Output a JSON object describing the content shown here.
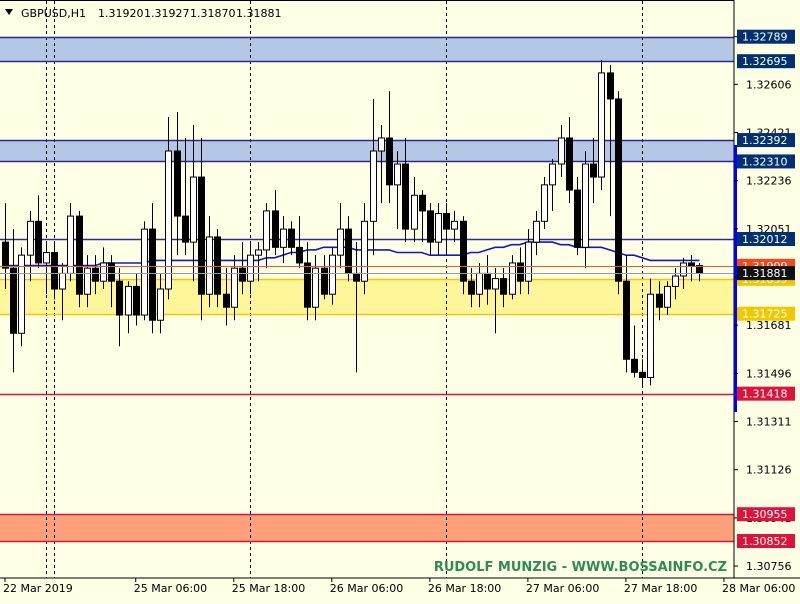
{
  "header": {
    "symbol": "GBPUSD,H1",
    "open": "1.31920",
    "high": "1.31927",
    "low": "1.31870",
    "close": "1.31881"
  },
  "watermark": "RUDOLF MUNZIG - WWW.BOSSAINFO.CZ",
  "colors": {
    "background": "#FFFFE6",
    "bull_candle": "#FFFFFF",
    "bear_candle": "#000000",
    "ma_line": "#1515C8",
    "blue_zone": "#B4C8E6",
    "blue_line": "#2B2B8F",
    "yellow_zone": "#FFF599",
    "yellow_border": "#F0C800",
    "red_zone": "#FFA07A",
    "red_line": "#D2143C",
    "label_dark": "#003070",
    "label_yellow": "#F0C800",
    "label_red": "#DC143C",
    "watermark": "#2E8B57"
  },
  "chart_data": {
    "type": "candlestick",
    "symbol": "GBPUSD",
    "timeframe": "H1",
    "ylim": [
      1.3071,
      1.3293
    ],
    "y_ticks": [
      "1.32789",
      "1.32606",
      "1.32421",
      "1.32236",
      "1.32051",
      "1.31866",
      "1.31681",
      "1.31496",
      "1.31311",
      "1.31126",
      "1.30941",
      "1.30756"
    ],
    "x_tick_labels": [
      "22 Mar 2019",
      "25 Mar 06:00",
      "25 Mar 18:00",
      "26 Mar 06:00",
      "26 Mar 18:00",
      "27 Mar 06:00",
      "27 Mar 18:00",
      "28 Mar 06:00"
    ],
    "x_tick_positions": [
      0,
      16,
      28,
      40,
      52,
      64,
      76,
      88
    ],
    "vertical_separators": [
      5,
      6,
      30,
      54,
      78
    ],
    "current_price": {
      "label": "1.31881",
      "value": 1.31881
    },
    "red_price_line": {
      "label": "1.31909",
      "value": 1.31909
    },
    "levels": [
      {
        "label": "1.32789",
        "value": 1.32789,
        "kind": "blue"
      },
      {
        "label": "1.32695",
        "value": 1.32695,
        "kind": "blue"
      },
      {
        "label": "1.32392",
        "value": 1.32392,
        "kind": "blue"
      },
      {
        "label": "1.32310",
        "value": 1.3231,
        "kind": "blue"
      },
      {
        "label": "1.32012",
        "value": 1.32012,
        "kind": "blue"
      },
      {
        "label": "1.31859",
        "value": 1.31859,
        "kind": "yellow"
      },
      {
        "label": "1.31725",
        "value": 1.31725,
        "kind": "yellow"
      },
      {
        "label": "1.31418",
        "value": 1.31418,
        "kind": "red"
      },
      {
        "label": "1.30955",
        "value": 1.30955,
        "kind": "red"
      },
      {
        "label": "1.30852",
        "value": 1.30852,
        "kind": "red"
      }
    ],
    "zones": [
      {
        "from": 1.32695,
        "to": 1.32789,
        "kind": "blue"
      },
      {
        "from": 1.3231,
        "to": 1.32392,
        "kind": "blue"
      },
      {
        "from": 1.31725,
        "to": 1.31859,
        "kind": "yellow"
      },
      {
        "from": 1.30852,
        "to": 1.30955,
        "kind": "red"
      }
    ],
    "ohlc": [
      [
        1.32,
        1.3215,
        1.3182,
        1.319
      ],
      [
        1.319,
        1.3205,
        1.315,
        1.3165
      ],
      [
        1.3165,
        1.3198,
        1.316,
        1.3195
      ],
      [
        1.3195,
        1.3212,
        1.3185,
        1.3208
      ],
      [
        1.3208,
        1.3218,
        1.319,
        1.3192
      ],
      [
        1.3192,
        1.32,
        1.318,
        1.3196
      ],
      [
        1.3196,
        1.32,
        1.3178,
        1.3182
      ],
      [
        1.3182,
        1.3192,
        1.317,
        1.3188
      ],
      [
        1.3188,
        1.3215,
        1.3185,
        1.321
      ],
      [
        1.321,
        1.3212,
        1.3175,
        1.318
      ],
      [
        1.318,
        1.3195,
        1.3175,
        1.319
      ],
      [
        1.319,
        1.3195,
        1.318,
        1.3185
      ],
      [
        1.3185,
        1.3198,
        1.3182,
        1.3192
      ],
      [
        1.3192,
        1.3195,
        1.3175,
        1.3185
      ],
      [
        1.3185,
        1.319,
        1.316,
        1.3172
      ],
      [
        1.3172,
        1.3185,
        1.3165,
        1.3183
      ],
      [
        1.3183,
        1.3188,
        1.3168,
        1.3172
      ],
      [
        1.3172,
        1.3208,
        1.317,
        1.3205
      ],
      [
        1.3205,
        1.3215,
        1.3165,
        1.317
      ],
      [
        1.317,
        1.3188,
        1.3165,
        1.3182
      ],
      [
        1.3182,
        1.3248,
        1.3178,
        1.3235
      ],
      [
        1.3235,
        1.325,
        1.3195,
        1.321
      ],
      [
        1.321,
        1.324,
        1.3195,
        1.32
      ],
      [
        1.32,
        1.3245,
        1.3185,
        1.3225
      ],
      [
        1.3225,
        1.324,
        1.317,
        1.318
      ],
      [
        1.318,
        1.321,
        1.3175,
        1.3202
      ],
      [
        1.3202,
        1.3205,
        1.3175,
        1.318
      ],
      [
        1.318,
        1.319,
        1.3168,
        1.3175
      ],
      [
        1.3175,
        1.3195,
        1.317,
        1.319
      ],
      [
        1.319,
        1.32,
        1.318,
        1.3185
      ],
      [
        1.3185,
        1.32,
        1.318,
        1.3195
      ],
      [
        1.3195,
        1.32,
        1.3185,
        1.3197
      ],
      [
        1.3197,
        1.3215,
        1.319,
        1.3212
      ],
      [
        1.3212,
        1.322,
        1.3195,
        1.3198
      ],
      [
        1.3198,
        1.321,
        1.3192,
        1.3205
      ],
      [
        1.3205,
        1.3208,
        1.3195,
        1.3198
      ],
      [
        1.3198,
        1.321,
        1.319,
        1.3192
      ],
      [
        1.3192,
        1.32,
        1.317,
        1.3175
      ],
      [
        1.3175,
        1.3195,
        1.317,
        1.319
      ],
      [
        1.319,
        1.3195,
        1.3178,
        1.318
      ],
      [
        1.318,
        1.3198,
        1.3176,
        1.3195
      ],
      [
        1.3195,
        1.3215,
        1.319,
        1.3205
      ],
      [
        1.3205,
        1.321,
        1.3185,
        1.3188
      ],
      [
        1.3188,
        1.32,
        1.315,
        1.3185
      ],
      [
        1.3185,
        1.3215,
        1.318,
        1.3208
      ],
      [
        1.3208,
        1.3255,
        1.3195,
        1.3235
      ],
      [
        1.3235,
        1.3245,
        1.3215,
        1.324
      ],
      [
        1.324,
        1.3258,
        1.3215,
        1.3222
      ],
      [
        1.3222,
        1.3235,
        1.3205,
        1.323
      ],
      [
        1.323,
        1.324,
        1.32,
        1.3205
      ],
      [
        1.3205,
        1.3225,
        1.32,
        1.3218
      ],
      [
        1.3218,
        1.322,
        1.32,
        1.3212
      ],
      [
        1.3212,
        1.3215,
        1.3195,
        1.32
      ],
      [
        1.32,
        1.3215,
        1.3195,
        1.3211
      ],
      [
        1.3211,
        1.3215,
        1.3195,
        1.3205
      ],
      [
        1.3205,
        1.3212,
        1.32,
        1.3208
      ],
      [
        1.3208,
        1.321,
        1.318,
        1.3185
      ],
      [
        1.3185,
        1.319,
        1.3175,
        1.318
      ],
      [
        1.318,
        1.3192,
        1.3175,
        1.3188
      ],
      [
        1.3188,
        1.3195,
        1.3176,
        1.3182
      ],
      [
        1.3182,
        1.319,
        1.3165,
        1.3186
      ],
      [
        1.3186,
        1.319,
        1.3175,
        1.318
      ],
      [
        1.318,
        1.3195,
        1.3178,
        1.3192
      ],
      [
        1.3192,
        1.3198,
        1.318,
        1.3185
      ],
      [
        1.3185,
        1.3205,
        1.318,
        1.32
      ],
      [
        1.32,
        1.3212,
        1.3195,
        1.3208
      ],
      [
        1.3208,
        1.3225,
        1.3205,
        1.3222
      ],
      [
        1.3222,
        1.3232,
        1.3212,
        1.323
      ],
      [
        1.323,
        1.3245,
        1.3225,
        1.324
      ],
      [
        1.324,
        1.3248,
        1.3215,
        1.322
      ],
      [
        1.322,
        1.3225,
        1.3195,
        1.3198
      ],
      [
        1.3198,
        1.3235,
        1.319,
        1.323
      ],
      [
        1.323,
        1.324,
        1.3215,
        1.3225
      ],
      [
        1.3225,
        1.327,
        1.322,
        1.3265
      ],
      [
        1.3265,
        1.3268,
        1.321,
        1.3255
      ],
      [
        1.3255,
        1.3258,
        1.318,
        1.3185
      ],
      [
        1.3185,
        1.3195,
        1.315,
        1.3155
      ],
      [
        1.3155,
        1.3168,
        1.3148,
        1.315
      ],
      [
        1.315,
        1.3155,
        1.3145,
        1.3148
      ],
      [
        1.3148,
        1.3186,
        1.3145,
        1.318
      ],
      [
        1.318,
        1.3185,
        1.317,
        1.3175
      ],
      [
        1.3175,
        1.3185,
        1.3172,
        1.3183
      ],
      [
        1.3183,
        1.319,
        1.3178,
        1.3187
      ],
      [
        1.3187,
        1.3194,
        1.3182,
        1.3192
      ],
      [
        1.3192,
        1.3195,
        1.3185,
        1.3191
      ],
      [
        1.3191,
        1.3192,
        1.3185,
        1.3188
      ]
    ],
    "ma": [
      1.3191,
      1.3191,
      1.3191,
      1.3191,
      1.3191,
      1.3191,
      1.3191,
      1.3191,
      1.3191,
      1.3191,
      1.3191,
      1.3191,
      1.3192,
      1.3192,
      1.3192,
      1.3192,
      1.3192,
      1.3192,
      1.3193,
      1.3193,
      1.3193,
      1.3193,
      1.3193,
      1.3193,
      1.3193,
      1.3193,
      1.3193,
      1.3193,
      1.3193,
      1.3193,
      1.3193,
      1.3193,
      1.3194,
      1.3194,
      1.3195,
      1.3196,
      1.3196,
      1.3197,
      1.3197,
      1.3198,
      1.3198,
      1.3198,
      1.3198,
      1.3197,
      1.3197,
      1.3197,
      1.3197,
      1.3197,
      1.3196,
      1.3196,
      1.3196,
      1.3196,
      1.3195,
      1.3195,
      1.3195,
      1.3195,
      1.3195,
      1.3196,
      1.3196,
      1.3197,
      1.3198,
      1.3198,
      1.3199,
      1.3199,
      1.32,
      1.32,
      1.32,
      1.32,
      1.3199,
      1.3199,
      1.3198,
      1.3198,
      1.3198,
      1.3198,
      1.3197,
      1.3196,
      1.3195,
      1.3195,
      1.3194,
      1.3193,
      1.3193,
      1.3193,
      1.3193,
      1.3193,
      1.3193,
      1.3193
    ]
  }
}
